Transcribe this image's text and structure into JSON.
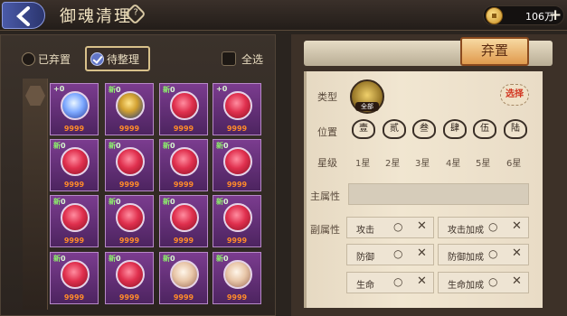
{
  "topbar": {
    "title": "御魂清理",
    "help_symbol": "?",
    "currency_amount": "106万"
  },
  "tabs": [
    {
      "label": "已弃置",
      "checked": false
    },
    {
      "label": "待整理",
      "checked": true
    },
    {
      "label": "全选",
      "checked": false
    }
  ],
  "grid": {
    "items": [
      {
        "tag_new": "",
        "tag_level": "+0",
        "stars": "9999",
        "orb": "blue"
      },
      {
        "tag_new": "新",
        "tag_level": "0",
        "stars": "9999",
        "orb": "gold"
      },
      {
        "tag_new": "新",
        "tag_level": "0",
        "stars": "9999",
        "orb": "red"
      },
      {
        "tag_new": "",
        "tag_level": "+0",
        "stars": "9999",
        "orb": "red"
      },
      {
        "tag_new": "新",
        "tag_level": "0",
        "stars": "9999",
        "orb": "red"
      },
      {
        "tag_new": "新",
        "tag_level": "0",
        "stars": "9999",
        "orb": "red"
      },
      {
        "tag_new": "新",
        "tag_level": "0",
        "stars": "9999",
        "orb": "red"
      },
      {
        "tag_new": "新",
        "tag_level": "0",
        "stars": "9999",
        "orb": "red"
      },
      {
        "tag_new": "新",
        "tag_level": "0",
        "stars": "9999",
        "orb": "red"
      },
      {
        "tag_new": "新",
        "tag_level": "0",
        "stars": "9999",
        "orb": "red"
      },
      {
        "tag_new": "新",
        "tag_level": "0",
        "stars": "9999",
        "orb": "red"
      },
      {
        "tag_new": "新",
        "tag_level": "0",
        "stars": "9999",
        "orb": "red"
      },
      {
        "tag_new": "新",
        "tag_level": "0",
        "stars": "9999",
        "orb": "red"
      },
      {
        "tag_new": "新",
        "tag_level": "0",
        "stars": "9999",
        "orb": "red"
      },
      {
        "tag_new": "新",
        "tag_level": "0",
        "stars": "9999",
        "orb": "pale"
      },
      {
        "tag_new": "新",
        "tag_level": "0",
        "stars": "9999",
        "orb": "pale"
      }
    ]
  },
  "detail": {
    "discard_label": "弃置",
    "type_label": "类型",
    "type_badge": "全部",
    "choose_label": "选择",
    "position_label": "位置",
    "positions": [
      "壹",
      "贰",
      "叁",
      "肆",
      "伍",
      "陆"
    ],
    "star_label": "星级",
    "star_options": [
      "1星",
      "2星",
      "3星",
      "4星",
      "5星",
      "6星"
    ],
    "main_attr_label": "主属性",
    "sub_attr_label": "副属性",
    "sub_attrs_left": [
      "攻击",
      "防御",
      "生命"
    ],
    "sub_attrs_right": [
      "攻击加成",
      "防御加成",
      "生命加成"
    ],
    "sub_option_o": "○",
    "sub_option_x": "✕"
  },
  "colors": {
    "accent_orange": "#e09a4d",
    "cell_purple": "#7b3c8f",
    "selected_tab": "#6276c8",
    "star_orange": "#ff8a2a",
    "new_green": "#8cf06b"
  }
}
